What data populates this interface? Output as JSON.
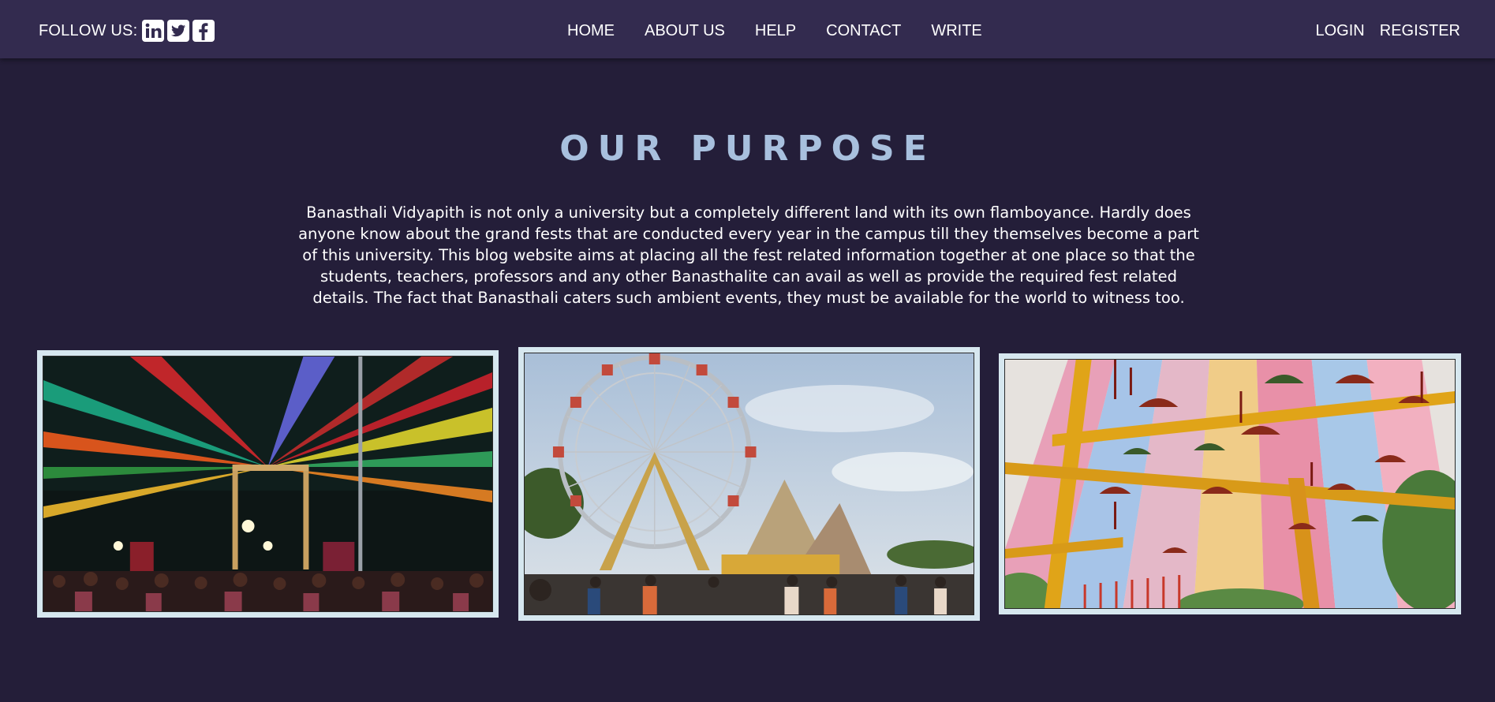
{
  "header": {
    "follow_label": "FOLLOW US:",
    "social": [
      {
        "name": "linkedin-icon",
        "glyph": "in"
      },
      {
        "name": "twitter-icon"
      },
      {
        "name": "facebook-icon",
        "glyph": "f"
      }
    ],
    "nav": [
      {
        "label": "HOME"
      },
      {
        "label": "ABOUT US"
      },
      {
        "label": "HELP"
      },
      {
        "label": "CONTACT"
      },
      {
        "label": "WRITE"
      }
    ],
    "auth": {
      "login": "LOGIN",
      "register": "REGISTER"
    }
  },
  "purpose": {
    "title": "OUR PURPOSE",
    "description": "Banasthali Vidyapith is not only a university but a completely different land with its own flamboyance. Hardly does anyone know about the grand fests that are conducted every year in the campus till they themselves become a part of this university. This blog website aims at placing all the fest related information together at one place so that the students, teachers, professors and any other Banasthalite can avail as well as provide the required fest related details. The fact that Banasthali caters such ambient events, they must be available for the world to witness too."
  },
  "gallery": [
    {
      "name": "gallery-photo-night-fest"
    },
    {
      "name": "gallery-photo-ferris-wheel"
    },
    {
      "name": "gallery-photo-umbrella-canopy"
    }
  ],
  "colors": {
    "background": "#241e39",
    "topbar": "#332b4f",
    "title": "#a8c0de",
    "photo_frame": "#d6e7ef"
  }
}
